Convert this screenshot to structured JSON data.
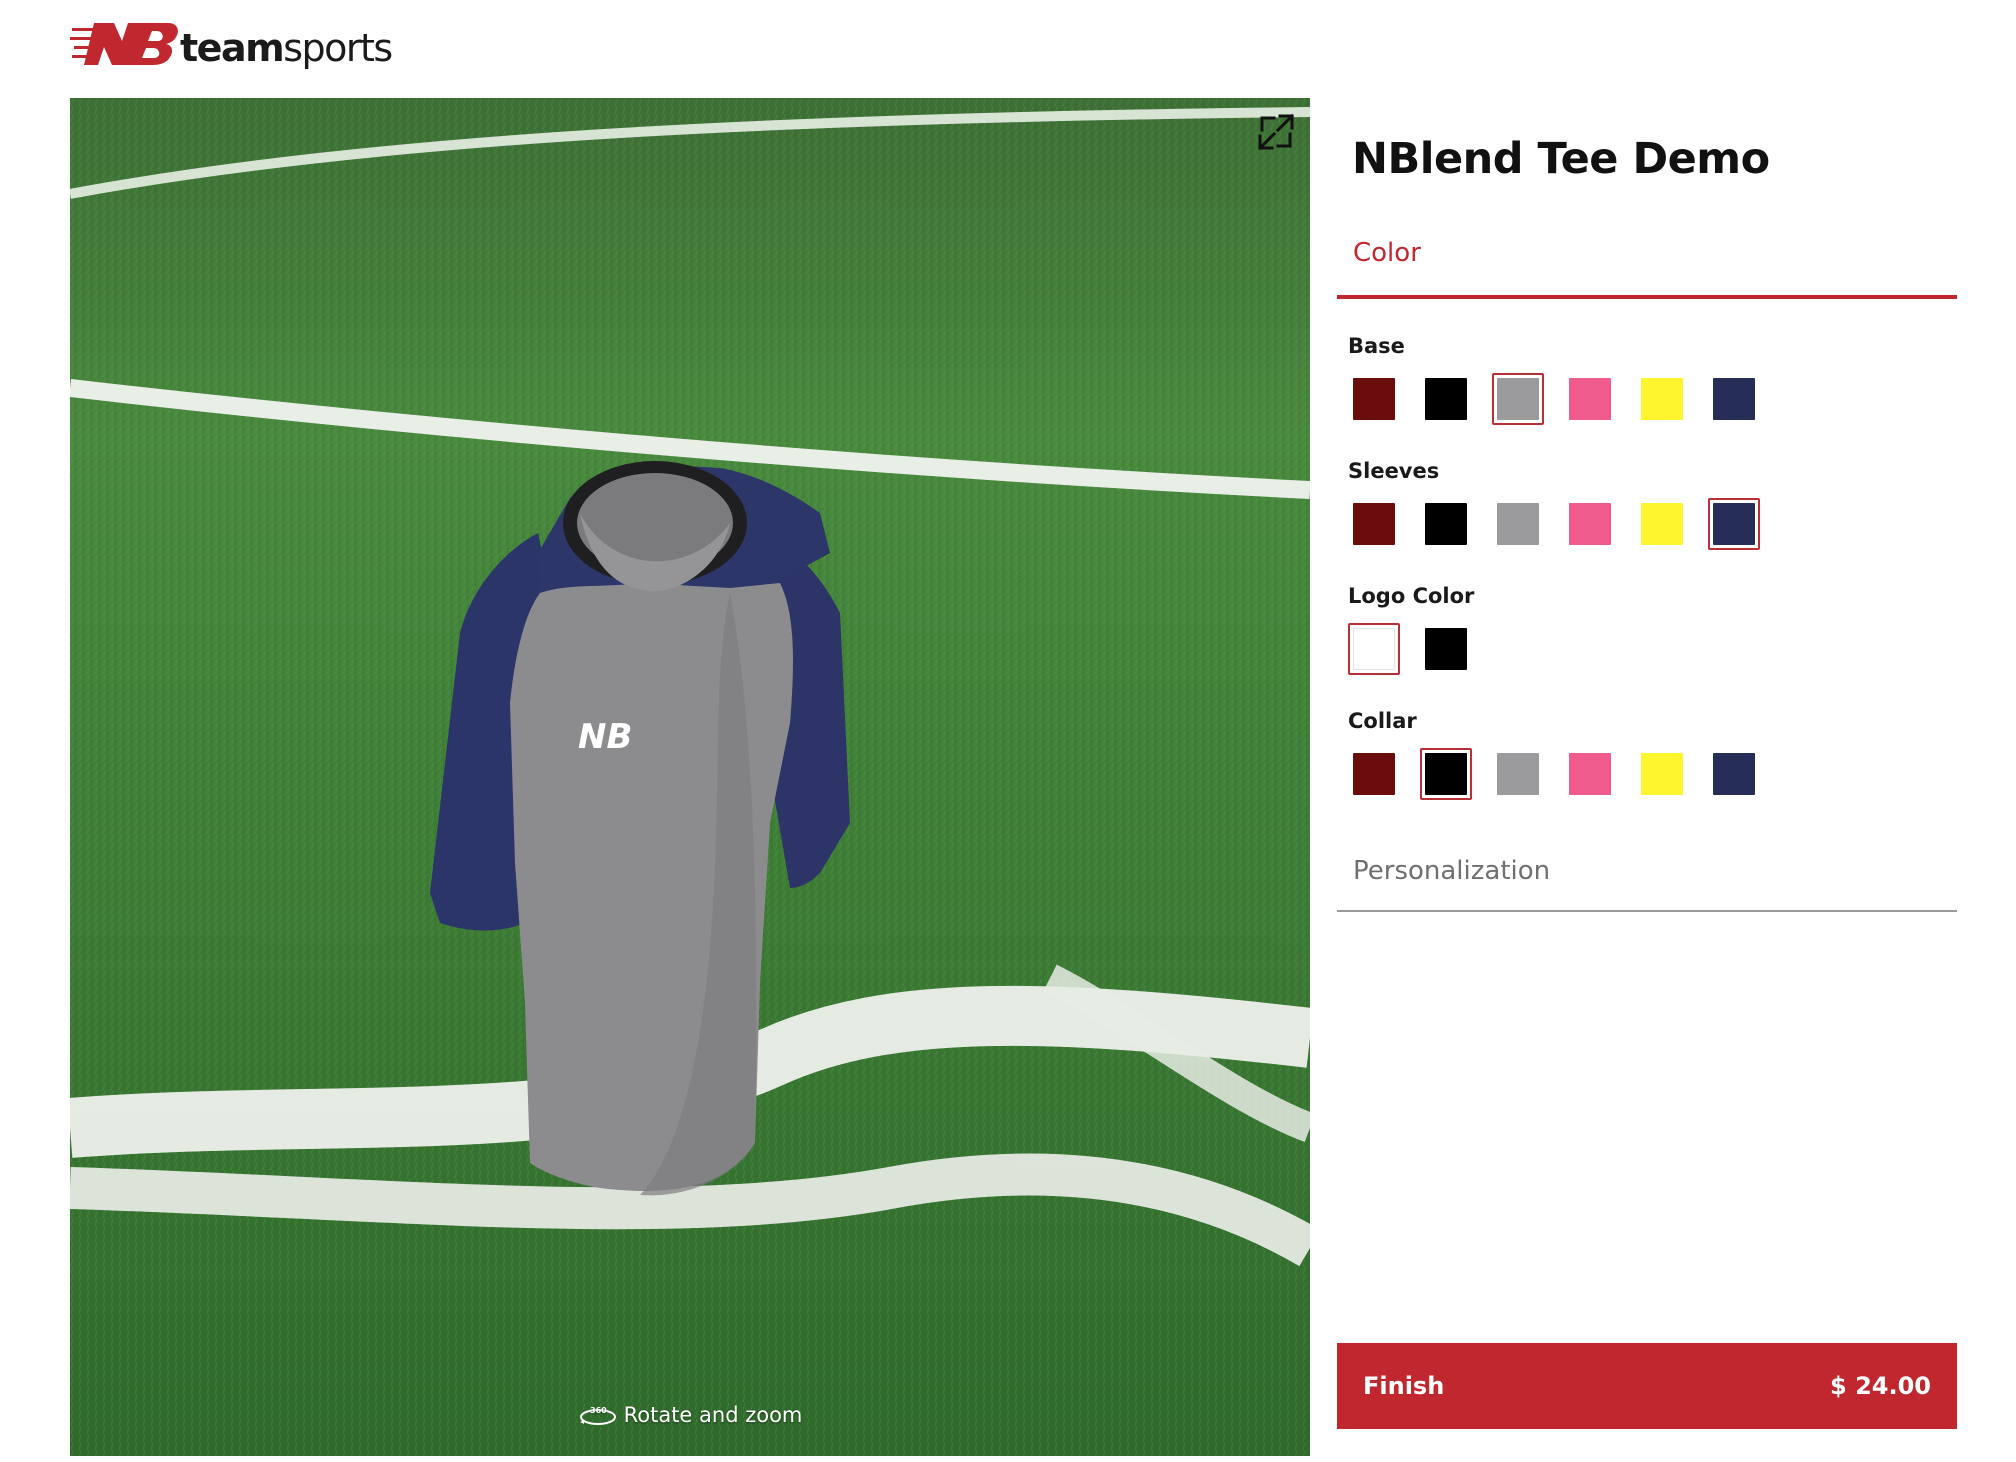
{
  "brand": {
    "logo_bold": "team",
    "logo_regular": "sports",
    "color": "#c0272f"
  },
  "viewer": {
    "expand_icon": "expand-icon",
    "rotate_icon": "360-rotate-icon",
    "rotate_label": "Rotate and zoom",
    "shirt_logo": "NB"
  },
  "product": {
    "title": "NBlend Tee Demo"
  },
  "tabs": {
    "color_label": "Color",
    "personalization_label": "Personalization"
  },
  "groups": [
    {
      "label": "Base",
      "swatches": [
        "#6b0d0d",
        "#000000",
        "#9b9b9d",
        "#ef5b8c",
        "#fff52e",
        "#262e58"
      ],
      "selected": 2
    },
    {
      "label": "Sleeves",
      "swatches": [
        "#6b0d0d",
        "#000000",
        "#9b9b9d",
        "#ef5b8c",
        "#fff52e",
        "#262e58"
      ],
      "selected": 5
    },
    {
      "label": "Logo Color",
      "swatches": [
        "#ffffff",
        "#000000"
      ],
      "selected": 0
    },
    {
      "label": "Collar",
      "swatches": [
        "#6b0d0d",
        "#000000",
        "#9b9b9d",
        "#ef5b8c",
        "#fff52e",
        "#262e58"
      ],
      "selected": 1
    }
  ],
  "finish": {
    "label": "Finish",
    "price": "$ 24.00"
  }
}
